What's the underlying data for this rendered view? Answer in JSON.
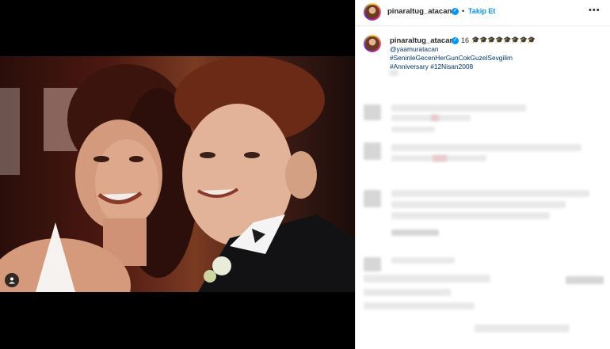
{
  "post": {
    "username": "pinaraltug_atacan",
    "separator": "•",
    "follow_label": "Takip Et",
    "more_label": "•••"
  },
  "caption": {
    "username": "pinaraltug_atacan",
    "count": "16",
    "emojis": "🎓🎓🎓🎓🎓🎓🎓🎓",
    "mention": "@yaamuratacan",
    "hashtag1": "#SeninleGecenHerGunCokGuzelSevgilim",
    "hashtag2": "#Anniversary #12Nisan2008"
  },
  "colors": {
    "link": "#00376b",
    "follow": "#0095f6",
    "verified": "#0095f6"
  },
  "icons": {
    "tag": "user-tag-icon",
    "verified": "verified-badge-icon",
    "more": "more-options-icon"
  }
}
